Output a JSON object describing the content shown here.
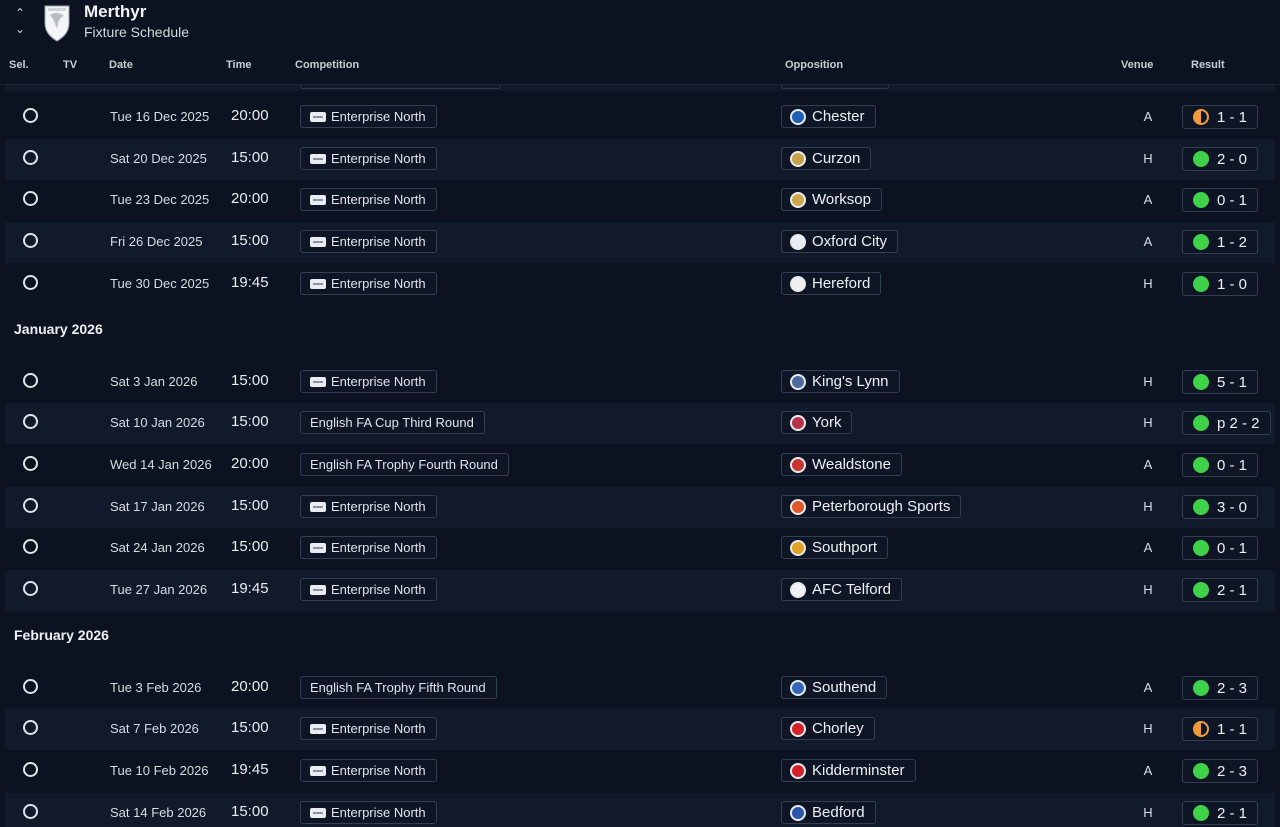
{
  "header": {
    "title": "Merthyr",
    "subtitle": "Fixture Schedule",
    "up_arrow": "⌃",
    "down_arrow": "⌄"
  },
  "columns": {
    "sel": "Sel.",
    "tv": "TV",
    "date": "Date",
    "time": "Time",
    "competition": "Competition",
    "opposition": "Opposition",
    "venue": "Venue",
    "result": "Result"
  },
  "colors": {
    "background": "#0c1220",
    "row_alt": "#111a2b",
    "win": "#3fd14a",
    "draw": "#f29b3c"
  },
  "groups": [
    {
      "month": "",
      "fixtures": [
        {
          "date": "Tue 16 Dec 2025",
          "time": "20:00",
          "competition": "Enterprise North",
          "comp_icon": true,
          "opposition": "Chester",
          "badge_color": "#1d5fb5",
          "venue": "A",
          "outcome": "draw",
          "result": "1 - 1"
        },
        {
          "date": "Sat 20 Dec 2025",
          "time": "15:00",
          "competition": "Enterprise North",
          "comp_icon": true,
          "opposition": "Curzon",
          "badge_color": "#c6a24a",
          "venue": "H",
          "outcome": "win",
          "result": "2 - 0"
        },
        {
          "date": "Tue 23 Dec 2025",
          "time": "20:00",
          "competition": "Enterprise North",
          "comp_icon": true,
          "opposition": "Worksop",
          "badge_color": "#caa94e",
          "venue": "A",
          "outcome": "win",
          "result": "0 - 1"
        },
        {
          "date": "Fri 26 Dec 2025",
          "time": "15:00",
          "competition": "Enterprise North",
          "comp_icon": true,
          "opposition": "Oxford City",
          "badge_color": "#e8ecf3",
          "venue": "A",
          "outcome": "win",
          "result": "1 - 2"
        },
        {
          "date": "Tue 30 Dec 2025",
          "time": "19:45",
          "competition": "Enterprise North",
          "comp_icon": true,
          "opposition": "Hereford",
          "badge_color": "#f0f0f0",
          "venue": "H",
          "outcome": "win",
          "result": "1 - 0"
        }
      ]
    },
    {
      "month": "January 2026",
      "fixtures": [
        {
          "date": "Sat 3 Jan 2026",
          "time": "15:00",
          "competition": "Enterprise North",
          "comp_icon": true,
          "opposition": "King's Lynn",
          "badge_color": "#4d6a9c",
          "venue": "H",
          "outcome": "win",
          "result": "5 - 1"
        },
        {
          "date": "Sat 10 Jan 2026",
          "time": "15:00",
          "competition": "English FA Cup Third Round",
          "comp_icon": false,
          "opposition": "York",
          "badge_color": "#b8324a",
          "venue": "H",
          "outcome": "win",
          "result": "p 2 - 2"
        },
        {
          "date": "Wed 14 Jan 2026",
          "time": "20:00",
          "competition": "English FA Trophy Fourth Round",
          "comp_icon": false,
          "opposition": "Wealdstone",
          "badge_color": "#c9362f",
          "venue": "A",
          "outcome": "win",
          "result": "0 - 1"
        },
        {
          "date": "Sat 17 Jan 2026",
          "time": "15:00",
          "competition": "Enterprise North",
          "comp_icon": true,
          "opposition": "Peterborough Sports",
          "badge_color": "#e0582a",
          "venue": "H",
          "outcome": "win",
          "result": "3 - 0"
        },
        {
          "date": "Sat 24 Jan 2026",
          "time": "15:00",
          "competition": "Enterprise North",
          "comp_icon": true,
          "opposition": "Southport",
          "badge_color": "#e0a224",
          "venue": "A",
          "outcome": "win",
          "result": "0 - 1"
        },
        {
          "date": "Tue 27 Jan 2026",
          "time": "19:45",
          "competition": "Enterprise North",
          "comp_icon": true,
          "opposition": "AFC Telford",
          "badge_color": "#f2f2f2",
          "venue": "H",
          "outcome": "win",
          "result": "2 - 1"
        }
      ]
    },
    {
      "month": "February 2026",
      "fixtures": [
        {
          "date": "Tue 3 Feb 2026",
          "time": "20:00",
          "competition": "English FA Trophy Fifth Round",
          "comp_icon": false,
          "opposition": "Southend",
          "badge_color": "#3366b8",
          "venue": "A",
          "outcome": "win",
          "result": "2 - 3"
        },
        {
          "date": "Sat 7 Feb 2026",
          "time": "15:00",
          "competition": "Enterprise North",
          "comp_icon": true,
          "opposition": "Chorley",
          "badge_color": "#d3202a",
          "venue": "H",
          "outcome": "draw",
          "result": "1 - 1"
        },
        {
          "date": "Tue 10 Feb 2026",
          "time": "19:45",
          "competition": "Enterprise North",
          "comp_icon": true,
          "opposition": "Kidderminster",
          "badge_color": "#d3202a",
          "venue": "A",
          "outcome": "win",
          "result": "2 - 3"
        },
        {
          "date": "Sat 14 Feb 2026",
          "time": "15:00",
          "competition": "Enterprise North",
          "comp_icon": true,
          "opposition": "Bedford",
          "badge_color": "#2a55a8",
          "venue": "H",
          "outcome": "win",
          "result": "2 - 1"
        }
      ]
    }
  ]
}
